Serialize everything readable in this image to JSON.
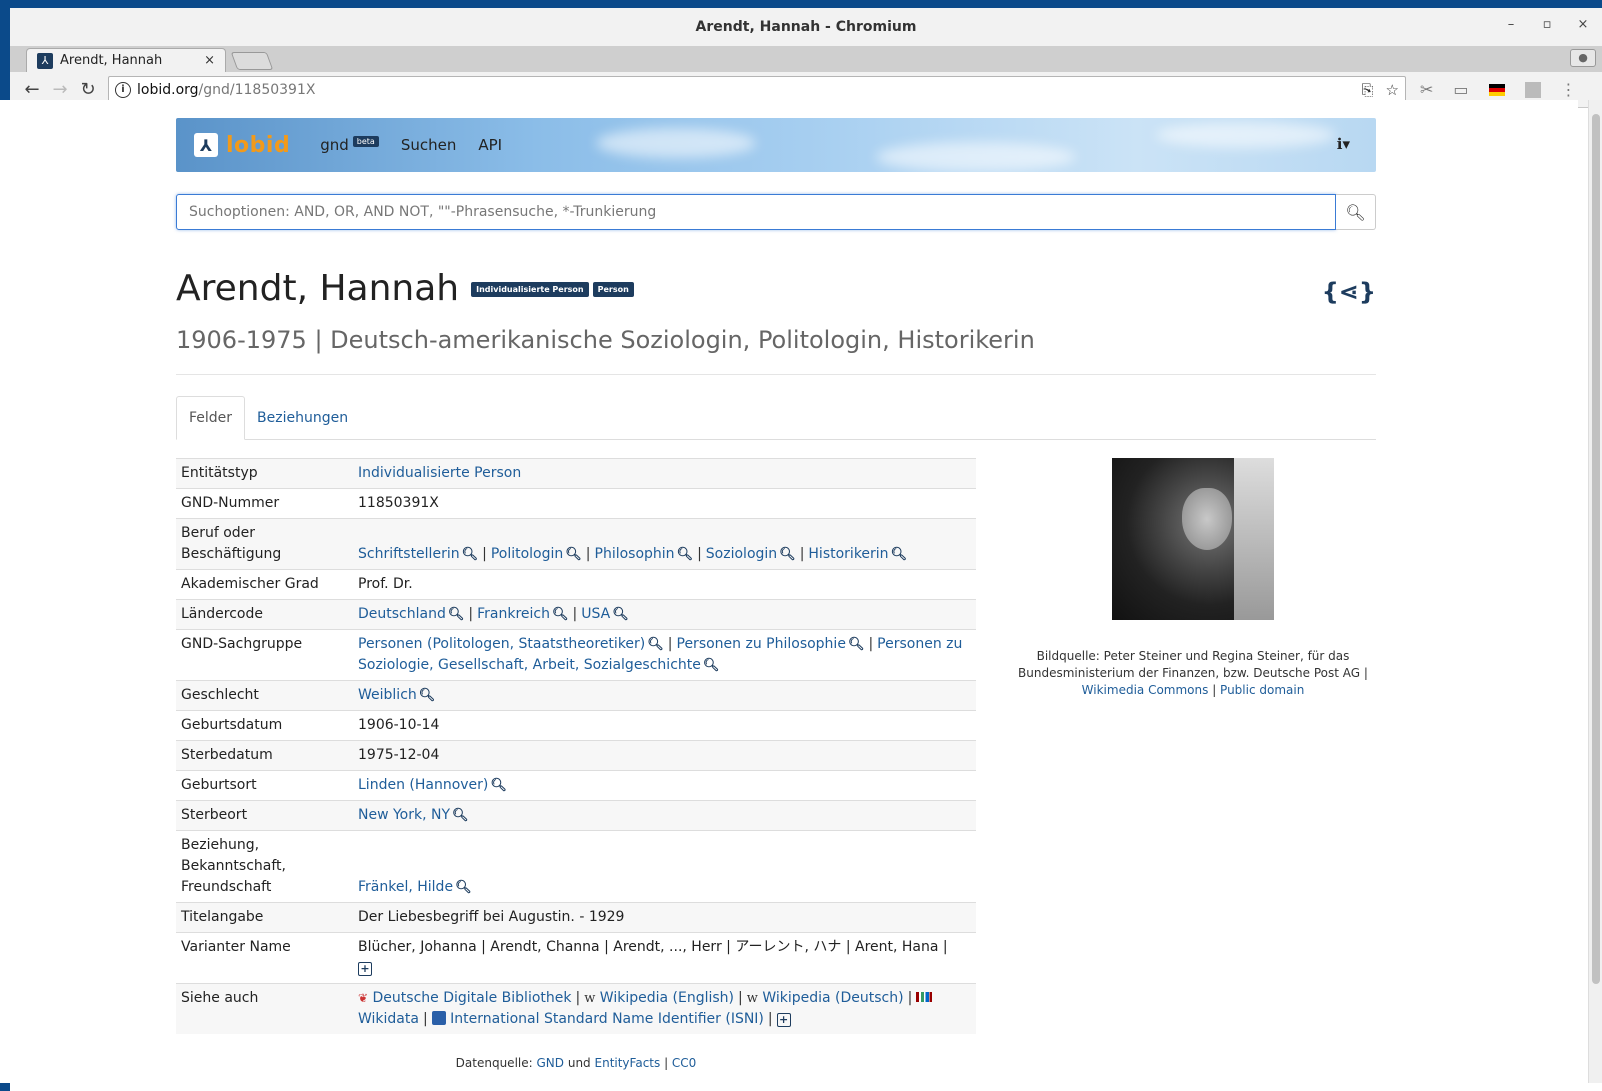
{
  "window": {
    "title": "Arendt, Hannah - Chromium",
    "controls": {
      "minimize": "–",
      "maximize": "▫",
      "close": "×"
    }
  },
  "tab": {
    "title": "Arendt, Hannah",
    "close": "×"
  },
  "address": {
    "host": "lobid.org",
    "path": "/gnd/11850391X"
  },
  "nav": {
    "brand": "lobid",
    "items": [
      {
        "label": "gnd",
        "badge": "beta"
      },
      {
        "label": "Suchen"
      },
      {
        "label": "API"
      }
    ],
    "info": "ℹ▾"
  },
  "search": {
    "placeholder": "Suchoptionen: AND, OR, AND NOT, \"\"-Phrasensuche, *-Trunkierung"
  },
  "entity": {
    "name": "Arendt, Hannah",
    "badges": [
      "Individualisierte Person",
      "Person"
    ],
    "subtitle": "1906-1975 | Deutsch-amerikanische Soziologin, Politologin, Historikerin"
  },
  "page_tabs": [
    "Felder",
    "Beziehungen"
  ],
  "fields": {
    "entitaetstyp": {
      "key": "Entitätstyp",
      "value": "Individualisierte Person"
    },
    "gnd_nummer": {
      "key": "GND-Nummer",
      "value": "11850391X"
    },
    "beruf": {
      "key": "Beruf oder Beschäftigung",
      "values": [
        "Schriftstellerin",
        "Politologin",
        "Philosophin",
        "Soziologin",
        "Historikerin"
      ]
    },
    "grad": {
      "key": "Akademischer Grad",
      "value": "Prof. Dr."
    },
    "laender": {
      "key": "Ländercode",
      "values": [
        "Deutschland",
        "Frankreich",
        "USA"
      ]
    },
    "sachgruppe": {
      "key": "GND-Sachgruppe",
      "values": [
        "Personen (Politologen, Staatstheoretiker)",
        "Personen zu Philosophie",
        "Personen zu Soziologie, Gesellschaft, Arbeit, Sozialgeschichte"
      ]
    },
    "geschlecht": {
      "key": "Geschlecht",
      "value": "Weiblich"
    },
    "geburtsdatum": {
      "key": "Geburtsdatum",
      "value": "1906-10-14"
    },
    "sterbedatum": {
      "key": "Sterbedatum",
      "value": "1975-12-04"
    },
    "geburtsort": {
      "key": "Geburtsort",
      "value": "Linden (Hannover)"
    },
    "sterbeort": {
      "key": "Sterbeort",
      "value": "New York, NY"
    },
    "beziehung": {
      "key": "Beziehung, Bekanntschaft, Freundschaft",
      "value": "Fränkel, Hilde"
    },
    "titel": {
      "key": "Titelangabe",
      "value": "Der Liebesbegriff bei Augustin. - 1929"
    },
    "variant": {
      "key": "Varianter Name",
      "value": "Blücher, Johanna | Arendt, Channa | Arendt, ..., Herr | アーレント, ハナ | Arent, Hana |"
    },
    "siehe": {
      "key": "Siehe auch",
      "links": [
        "Deutsche Digitale Bibliothek",
        "Wikipedia (English)",
        "Wikipedia (Deutsch)",
        "Wikidata",
        "International Standard Name Identifier (ISNI)"
      ]
    }
  },
  "image_caption": {
    "text": "Bildquelle: Peter Steiner und Regina Steiner, für das Bundesministerium der Finanzen, bzw. Deutsche Post AG |",
    "link1": "Wikimedia Commons",
    "link2": "Public domain"
  },
  "footer": {
    "prefix": "Datenquelle:",
    "gnd": "GND",
    "und": "und",
    "entityfacts": "EntityFacts",
    "cc0": "CC0"
  },
  "colors": {
    "accent": "#1d3c5e",
    "link": "#1f5d99",
    "brand": "#f29a1a"
  }
}
